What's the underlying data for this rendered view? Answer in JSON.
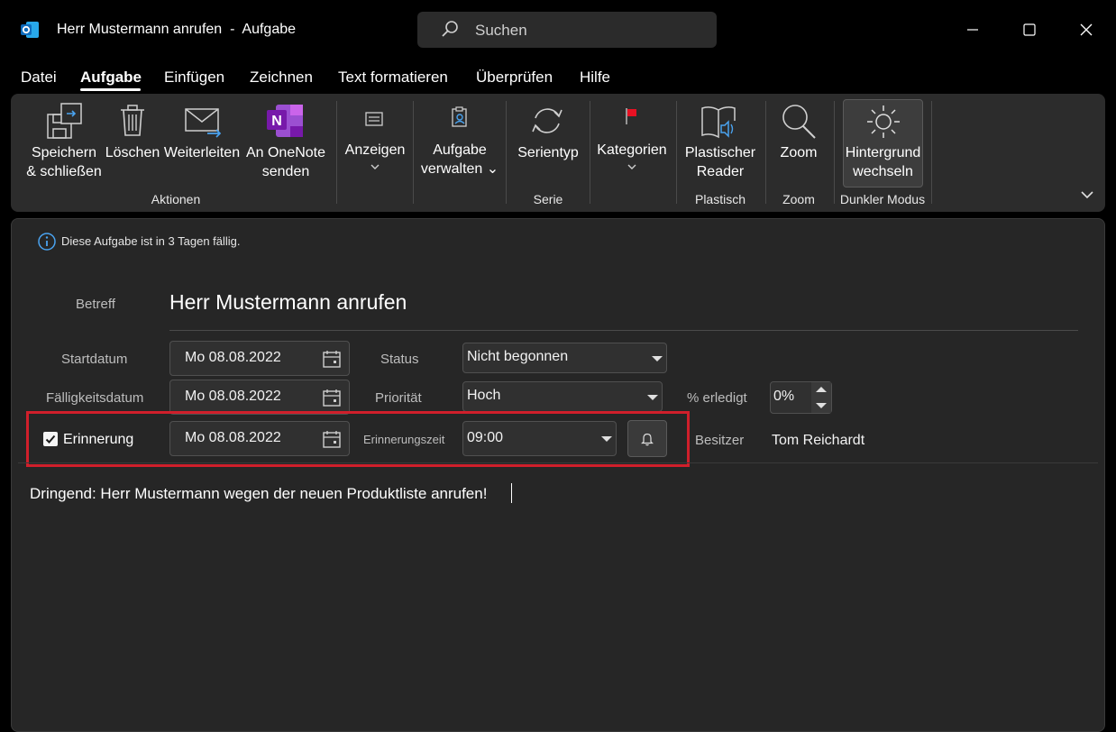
{
  "window": {
    "title": "Herr Mustermann anrufen  -  Aufgabe",
    "search_placeholder": "Suchen"
  },
  "menu": [
    "Datei",
    "Aufgabe",
    "Einfügen",
    "Zeichnen",
    "Text formatieren",
    "Überprüfen",
    "Hilfe"
  ],
  "menu_active": "Aufgabe",
  "ribbon": {
    "save_close": [
      "Speichern",
      "& schließen"
    ],
    "delete": "Löschen",
    "forward": "Weiterleiten",
    "onenote": [
      "An OneNote",
      "senden"
    ],
    "group_actions": "Aktionen",
    "show": "Anzeigen",
    "manage_task": [
      "Aufgabe",
      "verwalten ⌄"
    ],
    "recurrence": "Serientyp",
    "group_series": "Serie",
    "categories": "Kategorien",
    "immersive_reader": [
      "Plastischer",
      "Reader"
    ],
    "group_immersive": "Plastisch",
    "zoom": "Zoom",
    "group_zoom": "Zoom",
    "switch_background": [
      "Hintergrund",
      "wechseln"
    ],
    "group_dark_mode": "Dunkler Modus"
  },
  "info_bar": "Diese Aufgabe ist in 3 Tagen fällig.",
  "form": {
    "subject_label": "Betreff",
    "subject": "Herr Mustermann anrufen",
    "start_label": "Startdatum",
    "start_date": "Mo 08.08.2022",
    "due_label": "Fälligkeitsdatum",
    "due_date": "Mo 08.08.2022",
    "status_label": "Status",
    "status": "Nicht begonnen",
    "priority_label": "Priorität",
    "priority": "Hoch",
    "percent_label": "% erledigt",
    "percent": "0%",
    "reminder_label": "Erinnerung",
    "reminder_checked": true,
    "reminder_date": "Mo 08.08.2022",
    "reminder_time_label": "Erinnerungszeit",
    "reminder_time": "09:00",
    "owner_label": "Besitzer",
    "owner": "Tom Reichardt"
  },
  "body_text": "Dringend: Herr Mustermann wegen der neuen Produktliste anrufen!",
  "colors": {
    "highlight": "#d01f2b",
    "outlook_blue": "#0f6cbd",
    "onenote_purple": "#7719aa",
    "flag_red": "#e81123"
  }
}
